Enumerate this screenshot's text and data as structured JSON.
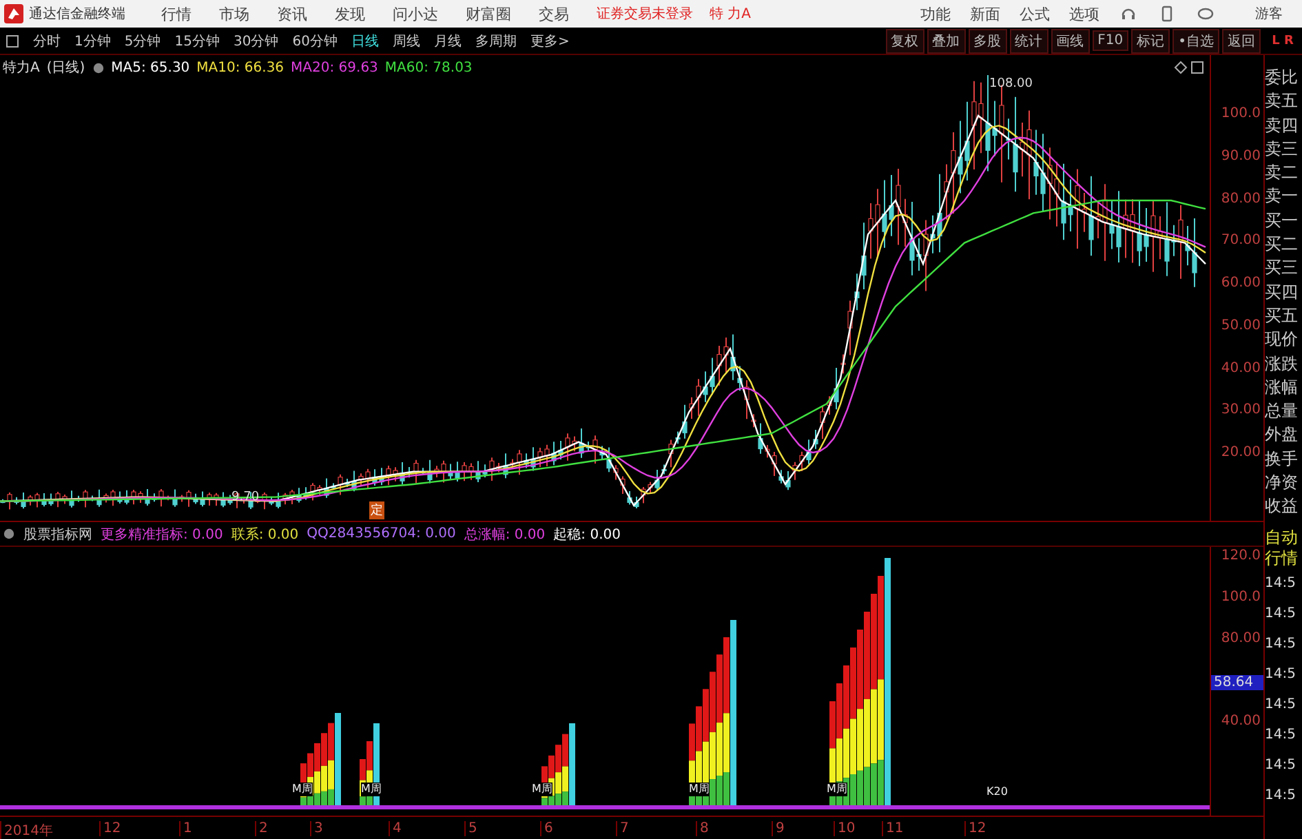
{
  "title_bar": {
    "app_name": "通达信金融终端",
    "menu": [
      "行情",
      "市场",
      "资讯",
      "发现",
      "问小达",
      "财富圈",
      "交易"
    ],
    "login_status": "证券交易未登录",
    "stock_name": "特 力A",
    "tools": [
      "功能",
      "新面",
      "公式",
      "选项"
    ],
    "user": "游客"
  },
  "toolbar": {
    "periods": [
      {
        "label": "分时",
        "selected": false
      },
      {
        "label": "1分钟",
        "selected": false
      },
      {
        "label": "5分钟",
        "selected": false
      },
      {
        "label": "15分钟",
        "selected": false
      },
      {
        "label": "30分钟",
        "selected": false
      },
      {
        "label": "60分钟",
        "selected": false
      },
      {
        "label": "日线",
        "selected": true
      },
      {
        "label": "周线",
        "selected": false
      },
      {
        "label": "月线",
        "selected": false
      },
      {
        "label": "多周期",
        "selected": false
      },
      {
        "label": "更多>",
        "selected": false
      }
    ],
    "layout_label": "L R",
    "buttons": [
      "复权",
      "叠加",
      "多股",
      "统计",
      "画线",
      "F10",
      "标记",
      "•自选",
      "返回"
    ]
  },
  "price_chart": {
    "title": "特力A",
    "period": "(日线)",
    "indicators": [
      {
        "label": "MA5: 65.30",
        "color": "#ffffff"
      },
      {
        "label": "MA10: 66.36",
        "color": "#f0e040"
      },
      {
        "label": "MA20: 69.63",
        "color": "#e040e0"
      },
      {
        "label": "MA60: 78.03",
        "color": "#40e040"
      }
    ],
    "axis_labels": [
      "100.0",
      "90.00",
      "80.00",
      "70.00",
      "60.00",
      "50.00",
      "40.00",
      "30.00",
      "20.00"
    ],
    "high_label": "108.00",
    "low_label": "9.70",
    "marker": "定"
  },
  "indicator_chart": {
    "name": "股票指标网",
    "values": [
      {
        "label": "更多精准指标:",
        "value": "0.00",
        "color": "#e040e0"
      },
      {
        "label": "联系:",
        "value": "0.00",
        "color": "#e0e040"
      },
      {
        "label": "QQ2843556704:",
        "value": "0.00",
        "color": "#b070ff"
      },
      {
        "label": "总涨幅:",
        "value": "0.00",
        "color": "#e040e0"
      },
      {
        "label": "起稳:",
        "value": "0.00",
        "color": "#ffffff"
      }
    ],
    "axis_labels": [
      "120.0",
      "100.0",
      "80.00",
      "40.00"
    ],
    "current_value": "58.64",
    "labels": [
      "M周",
      "M周",
      "M周",
      "M周",
      "M周",
      "K20"
    ]
  },
  "date_axis": [
    "2014年",
    "12",
    "1",
    "2",
    "3",
    "4",
    "5",
    "6",
    "7",
    "8",
    "9",
    "10",
    "11",
    "12"
  ],
  "quote_panel": {
    "fields": [
      "委比",
      "卖五",
      "卖四",
      "卖三",
      "卖二",
      "卖一",
      "买一",
      "买二",
      "买三",
      "买四",
      "买五",
      "现价",
      "涨跌",
      "涨幅",
      "总量",
      "外盘",
      "换手",
      "净资",
      "收益"
    ],
    "mode_labels": [
      "自动",
      "行情"
    ],
    "times": [
      "14:5",
      "14:5",
      "14:5",
      "14:5",
      "14:5",
      "14:5",
      "14:5",
      "14:5"
    ]
  }
}
